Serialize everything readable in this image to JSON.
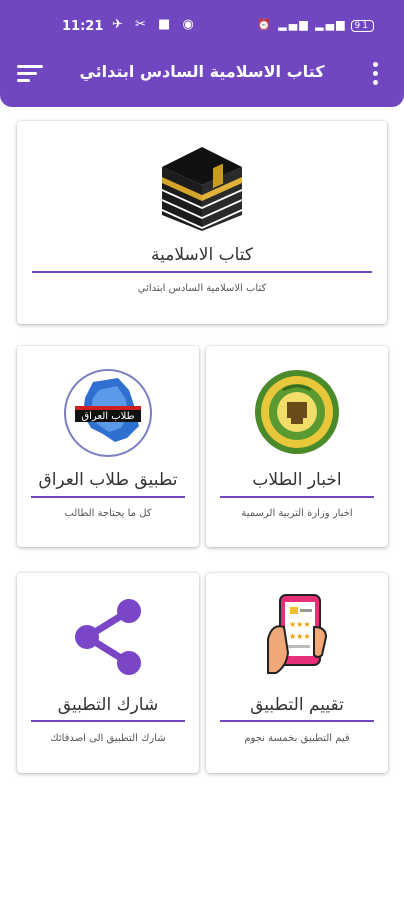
{
  "status_bar": {
    "time": "11:21",
    "battery": "91"
  },
  "appbar": {
    "title": "كتاب الاسلامية السادس ابتدائي",
    "color": "#7047c0"
  },
  "cards": {
    "book": {
      "title": "كتاب الاسلامية",
      "subtitle": "كتاب الاسلامية السادس ابتدائي",
      "icon": "kaaba-icon"
    },
    "news": {
      "title": "اخبار الطلاب",
      "subtitle": "اخبار وزارة التربية الرسمية",
      "icon": "ministry-emblem-icon"
    },
    "app": {
      "title": "تطبيق طلاب العراق",
      "subtitle": "كل ما يحتاجة الطالب",
      "icon": "iraq-map-logo-icon",
      "logo_text": "طلاب العراق"
    },
    "rate": {
      "title": "تقييم التطبيق",
      "subtitle": "قيم التطبيق بخمسة نجوم",
      "icon": "rate-phone-icon"
    },
    "share": {
      "title": "شارك التطبيق",
      "subtitle": "شارك التطبيق الى اصدقائك",
      "icon": "share-icon"
    }
  }
}
